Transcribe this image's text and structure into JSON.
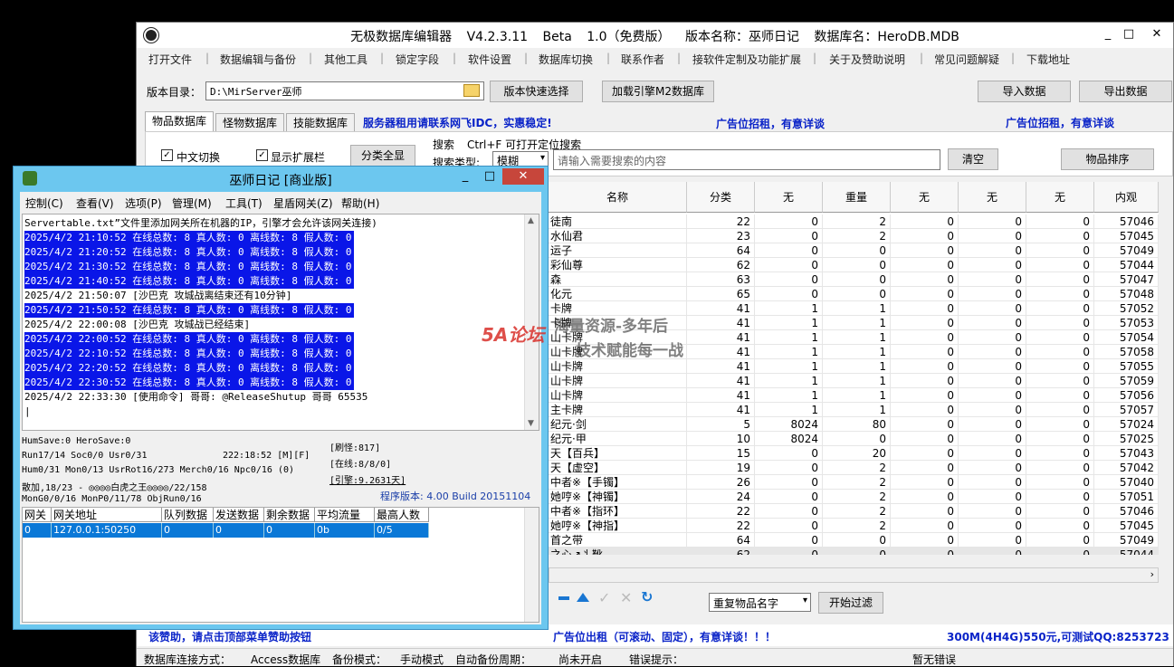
{
  "main_window": {
    "title": "无极数据库编辑器 V4.2.3.11  Beta 1.0（免费版）  版本名称：巫师日记  数据库名：HeroDB.MDB",
    "controls": {
      "minimize": "_",
      "maximize": "□",
      "close": "✕"
    },
    "menu": [
      "打开文件",
      "数据编辑与备份",
      "其他工具",
      "锁定字段",
      "软件设置",
      "数据库切换",
      "联系作者",
      "接软件定制及功能扩展",
      "关于及赞助说明",
      "常见问题解疑",
      "下载地址"
    ],
    "version_dir_label": "版本目录：",
    "version_dir_value": "D:\\MirServer巫师",
    "buttons": {
      "quick_select": "版本快速选择",
      "load_engine": "加载引擎M2数据库",
      "import": "导入数据",
      "export": "导出数据",
      "show_all": "分类全显",
      "clear": "清空",
      "sort_items": "物品排序",
      "start_filter": "开始过滤"
    },
    "tabs": [
      "物品数据库",
      "怪物数据库",
      "技能数据库"
    ],
    "ads": {
      "server_rent": "服务器租用请联系网飞IDC，实惠稳定!",
      "ad_slot_1": "广告位招租，有意详谈",
      "ad_slot_2": "广告位招租，有意详谈",
      "ad_bottom": "广告位出租（可滚动、固定），有意详谈！！！",
      "ad_price": "300M(4H4G)550元,可测试QQ:8253723",
      "donate": "该赞助，请点击顶部菜单赞助按钮"
    },
    "checkboxes": {
      "chinese_switch": "中文切换",
      "show_ext": "显示扩展栏"
    },
    "search": {
      "label": "搜索",
      "hint": "Ctrl+F 可打开定位搜索",
      "type_label": "搜索类型:",
      "type_value": "模糊",
      "placeholder": "请输入需要搜索的内容"
    },
    "filter_select": "重复物品名字",
    "grid": {
      "columns": [
        "名称",
        "分类",
        "无",
        "重量",
        "无",
        "无",
        "无",
        "内观"
      ],
      "rows": [
        [
          "徒南",
          "22",
          "0",
          "2",
          "0",
          "0",
          "0",
          "57046"
        ],
        [
          "水仙君",
          "23",
          "0",
          "2",
          "0",
          "0",
          "0",
          "57045"
        ],
        [
          "运子",
          "64",
          "0",
          "0",
          "0",
          "0",
          "0",
          "57049"
        ],
        [
          "彩仙尊",
          "62",
          "0",
          "0",
          "0",
          "0",
          "0",
          "57044"
        ],
        [
          "森",
          "63",
          "0",
          "0",
          "0",
          "0",
          "0",
          "57047"
        ],
        [
          "化元",
          "65",
          "0",
          "0",
          "0",
          "0",
          "0",
          "57048"
        ],
        [
          "卡牌",
          "41",
          "1",
          "1",
          "0",
          "0",
          "0",
          "57052"
        ],
        [
          "卡牌",
          "41",
          "1",
          "1",
          "0",
          "0",
          "0",
          "57053"
        ],
        [
          "山卡牌",
          "41",
          "1",
          "1",
          "0",
          "0",
          "0",
          "57054"
        ],
        [
          "山卡牌",
          "41",
          "1",
          "1",
          "0",
          "0",
          "0",
          "57058"
        ],
        [
          "山卡牌",
          "41",
          "1",
          "1",
          "0",
          "0",
          "0",
          "57055"
        ],
        [
          "山卡牌",
          "41",
          "1",
          "1",
          "0",
          "0",
          "0",
          "57059"
        ],
        [
          "山卡牌",
          "41",
          "1",
          "1",
          "0",
          "0",
          "0",
          "57056"
        ],
        [
          "主卡牌",
          "41",
          "1",
          "1",
          "0",
          "0",
          "0",
          "57057"
        ],
        [
          "纪元·剑",
          "5",
          "8024",
          "80",
          "0",
          "0",
          "0",
          "57024"
        ],
        [
          "纪元·甲",
          "10",
          "8024",
          "0",
          "0",
          "0",
          "0",
          "57025"
        ],
        [
          "天【百兵】",
          "15",
          "0",
          "20",
          "0",
          "0",
          "0",
          "57043"
        ],
        [
          "天【虚空】",
          "19",
          "0",
          "2",
          "0",
          "0",
          "0",
          "57042"
        ],
        [
          "中者※【手镯】",
          "26",
          "0",
          "2",
          "0",
          "0",
          "0",
          "57040"
        ],
        [
          "她哼※【神镯】",
          "24",
          "0",
          "2",
          "0",
          "0",
          "0",
          "57051"
        ],
        [
          "中者※【指环】",
          "22",
          "0",
          "2",
          "0",
          "0",
          "0",
          "57046"
        ],
        [
          "她哼※【神指】",
          "22",
          "0",
          "2",
          "0",
          "0",
          "0",
          "57045"
        ],
        [
          "首之带",
          "64",
          "0",
          "0",
          "0",
          "0",
          "0",
          "57049"
        ],
        [
          "之心↗丬靴",
          "62",
          "0",
          "0",
          "0",
          "0",
          "0",
          "57044"
        ]
      ]
    },
    "status_bar": {
      "conn_label": "数据库连接方式：",
      "conn_value": "Access数据库",
      "backup_label": "备份模式：",
      "backup_value": "手动模式",
      "auto_label": "自动备份周期：",
      "auto_value": "尚未开启",
      "error_label": "错误提示：",
      "error_value": "暂无错误"
    }
  },
  "child_window": {
    "title": "巫师日记 [商业版]",
    "controls": {
      "minimize": "_",
      "maximize": "□",
      "close": "✕"
    },
    "menu": [
      "控制(C)",
      "查看(V)",
      "选项(P)",
      "管理(M)",
      "工具(T)",
      "星盾网关(Z)",
      "帮助(H)"
    ],
    "log": [
      {
        "text": "Servertable.txt”文件里添加网关所在机器的IP，引擎才会允许该网关连接)",
        "hl": false
      },
      {
        "text": "2025/4/2 21:10:52 在线总数: 8 真人数: 0 离线数: 8 假人数: 0",
        "hl": true
      },
      {
        "text": "2025/4/2 21:20:52 在线总数: 8 真人数: 0 离线数: 8 假人数: 0",
        "hl": true
      },
      {
        "text": "2025/4/2 21:30:52 在线总数: 8 真人数: 0 离线数: 8 假人数: 0",
        "hl": true
      },
      {
        "text": "2025/4/2 21:40:52 在线总数: 8 真人数: 0 离线数: 8 假人数: 0",
        "hl": true
      },
      {
        "text": "2025/4/2 21:50:07 [沙巴克 攻城战离结束还有10分钟]",
        "hl": false
      },
      {
        "text": "2025/4/2 21:50:52 在线总数: 8 真人数: 0 离线数: 8 假人数: 0",
        "hl": true
      },
      {
        "text": "2025/4/2 22:00:08 [沙巴克 攻城战已经结束]",
        "hl": false
      },
      {
        "text": "2025/4/2 22:00:52 在线总数: 8 真人数: 0 离线数: 8 假人数: 0",
        "hl": true
      },
      {
        "text": "2025/4/2 22:10:52 在线总数: 8 真人数: 0 离线数: 8 假人数: 0",
        "hl": true
      },
      {
        "text": "2025/4/2 22:20:52 在线总数: 8 真人数: 0 离线数: 8 假人数: 0",
        "hl": true
      },
      {
        "text": "2025/4/2 22:30:52 在线总数: 8 真人数: 0 离线数: 8 假人数: 0",
        "hl": true
      },
      {
        "text": "2025/4/2 22:33:30 [使用命令] 哥哥: @ReleaseShutup 哥哥 65535",
        "hl": false
      }
    ],
    "stats": {
      "line1": "HumSave:0 HeroSave:0",
      "line2": "Run17/14 Soc0/0 Usr0/31",
      "time": "222:18:52 [M][F]",
      "line3": "Hum0/31 Mon0/13 UsrRot16/273 Merch0/16 Npc0/16 (0)",
      "line4": "散加,18/23 - ◎◎◎◎白虎之王◎◎◎◎/22/158",
      "line5": "MonG0/0/16 MonP0/11/78 ObjRun0/16",
      "refresh": "[刷怪:817]",
      "online": "[在线:8/8/0]",
      "engine": "[引擎:9.2631天]",
      "version": "程序版本: 4.00 Build 20151104"
    },
    "gateway_table": {
      "columns": [
        "网关",
        "网关地址",
        "队列数据",
        "发送数据",
        "剩余数据",
        "平均流量",
        "最高人数"
      ],
      "rows": [
        [
          "0",
          "127.0.0.1:50250",
          "0",
          "0",
          "0",
          "0b",
          "0/5"
        ]
      ]
    }
  },
  "watermark": {
    "logo_text": "5A论坛",
    "line1": "海量资源-多年后",
    "line2": "技术赋能每一战"
  },
  "colors": {
    "highlight_blue": "#0a16e8",
    "child_frame": "#6cc7ef",
    "ad_blue": "#0a23c8"
  }
}
